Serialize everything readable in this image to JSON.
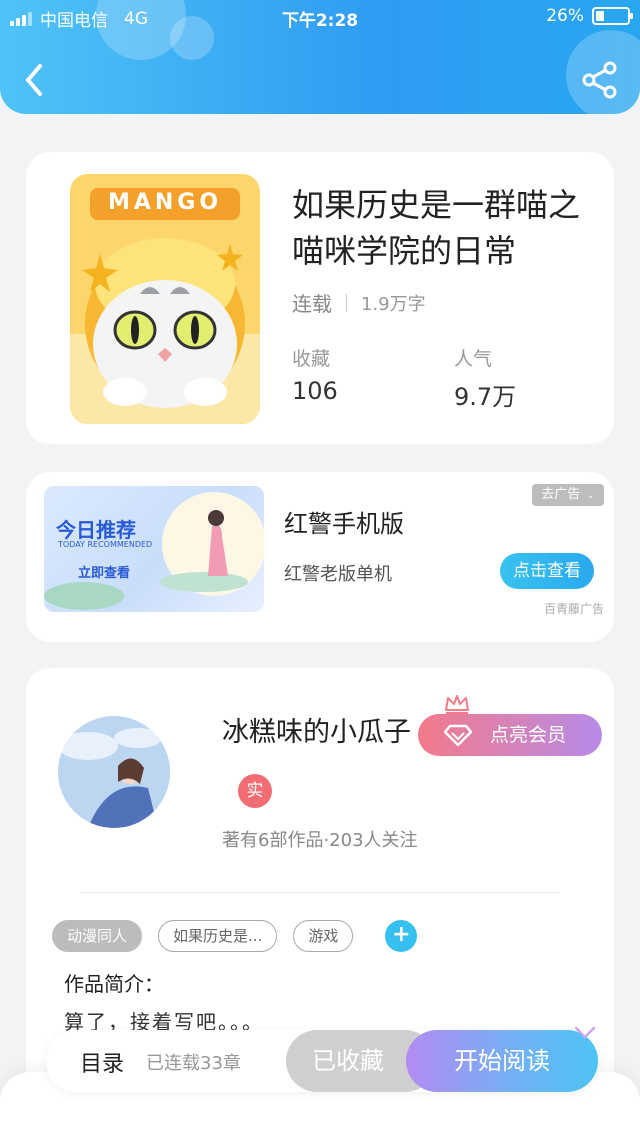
{
  "status_bar": {
    "carrier": "中国电信",
    "network": "4G",
    "time": "下午2:28",
    "battery_text": "26%",
    "battery_level": 0.26
  },
  "header": {
    "back_icon": "chevron-left-icon",
    "share_icon": "share-icon"
  },
  "book": {
    "cover_text": "MANGO",
    "title": "如果历史是一群喵之喵咪学院的日常",
    "status": "连载",
    "word_count": "1.9万字",
    "stats": [
      {
        "label": "收藏",
        "value": "106"
      },
      {
        "label": "人气",
        "value": "9.7万"
      }
    ]
  },
  "ad": {
    "image_title": "今日推荐",
    "image_subtitle": "TODAY RECOMMENDED",
    "image_button": "立即查看",
    "title": "红警手机版",
    "subtitle": "红警老版单机",
    "cta": "点击查看",
    "close_label": "去广告",
    "source": "百青藤广告"
  },
  "author": {
    "name": "冰糕味的小瓜子",
    "vip_label": "点亮会员",
    "verified_badge": "实",
    "meta": "著有6部作品·203人关注"
  },
  "tags": [
    {
      "label": "动漫同人",
      "style": "filled"
    },
    {
      "label": "如果历史是...",
      "style": "outline"
    },
    {
      "label": "游戏",
      "style": "outline"
    }
  ],
  "intro": {
    "label": "作品简介：",
    "text": "算了，接着写吧。。。"
  },
  "bottom": {
    "toc_label": "目录",
    "serial_count": "已连载33章",
    "collected_label": "已收藏",
    "read_label": "开始阅读"
  },
  "colors": {
    "header_blue": "#2f9bf2",
    "accent_cyan": "#35c0ef",
    "vip_pink": "#f47a8a",
    "vip_purple": "#b78be8"
  }
}
